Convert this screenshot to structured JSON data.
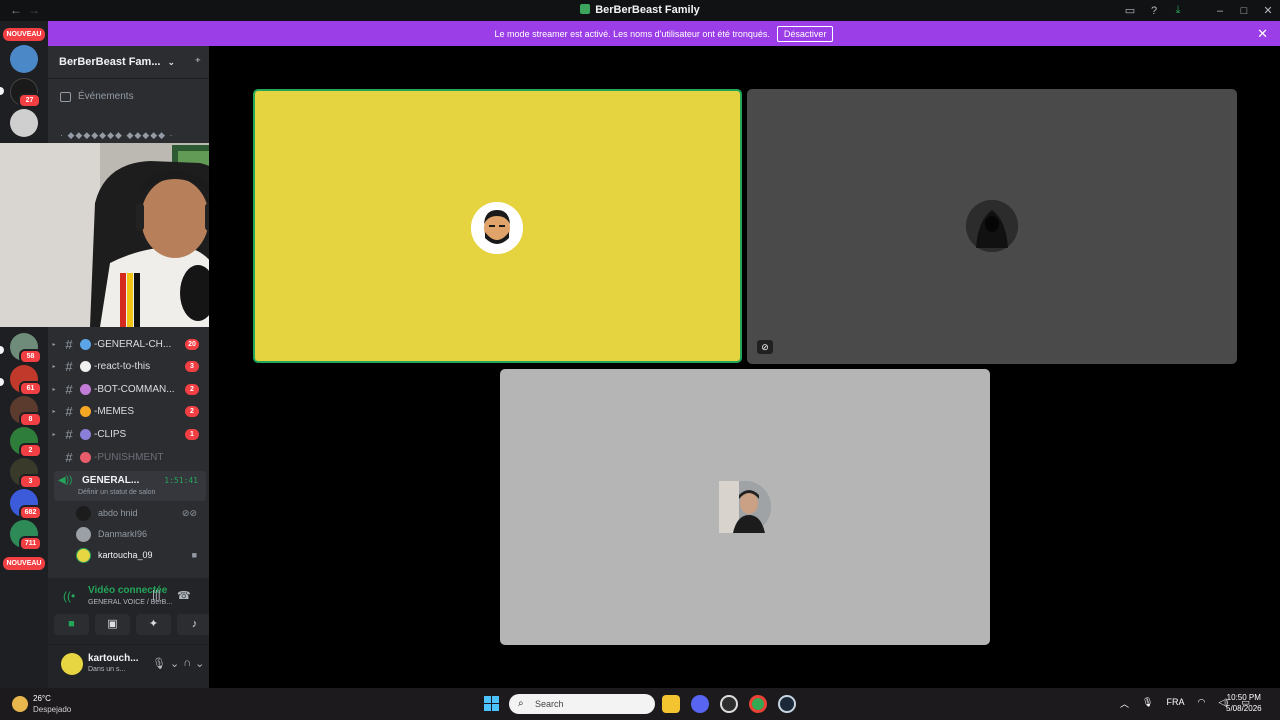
{
  "window": {
    "title": "BerBerBeast Family",
    "back_icon": "arrow-left-icon",
    "forward_icon": "arrow-right-icon"
  },
  "banner": {
    "text": "Le mode streamer est activé. Les noms d'utilisateur ont été tronqués.",
    "button": "Désactiver",
    "color": "#9b3ee8"
  },
  "servers": {
    "nouveau_label": "NOUVEAU",
    "badges": [
      "27",
      "58",
      "61",
      "8",
      "2",
      "3",
      "682",
      "711"
    ]
  },
  "sidebar": {
    "guild_name": "BerBerBeast Fam...",
    "events_label": "Événements",
    "category_fragment": "· ◆◆◆◆◆◆◆ ◆◆◆◆◆ ·",
    "channels": [
      {
        "name": "-GENERAL-CH...",
        "count": "20",
        "emoji_color": "#5ba4e6"
      },
      {
        "name": "-react-to-this",
        "count": "3",
        "emoji_color": "#f0f0f0"
      },
      {
        "name": "-BOT-COMMAN...",
        "count": "2",
        "emoji_color": "#c27bd6"
      },
      {
        "name": "-MEMES",
        "count": "2",
        "emoji_color": "#f5a623"
      },
      {
        "name": "-CLIPS",
        "count": "1",
        "emoji_color": "#8a7fd8"
      },
      {
        "name": "-PUNISHMENT",
        "count": "",
        "emoji_color": "#e85d6a"
      }
    ],
    "voice_channel": {
      "name": "GENERAL...",
      "timer": "1:51:41",
      "status": "Définir un statut de salon"
    },
    "voice_users": [
      {
        "name": "abdo hnid"
      },
      {
        "name": "DanmarkI96"
      },
      {
        "name": "kartoucha_09"
      }
    ]
  },
  "rtc": {
    "status": "Vidéo connectée",
    "channel": "GENERAL VOICE / BerB..."
  },
  "user": {
    "name": "kartouch...",
    "status": "Dans un s..."
  },
  "stage": {
    "tiles": [
      {
        "name": "tile-kartoucha",
        "bg": "#e5d43f",
        "border": "#23a55a"
      },
      {
        "name": "tile-abdo",
        "bg": "#4a4a4a"
      },
      {
        "name": "tile-danmark",
        "bg": "#b4b5b4"
      }
    ]
  },
  "taskbar": {
    "temperature": "26°C",
    "condition": "Despejado",
    "search_placeholder": "Search",
    "language": "FRA",
    "time": "10:50 PM",
    "date": "5/08/2026"
  }
}
